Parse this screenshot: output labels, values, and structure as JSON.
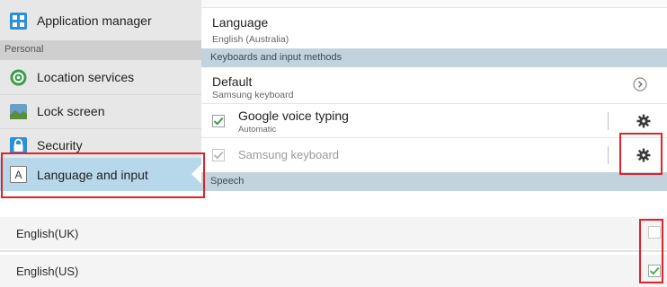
{
  "sidebar": {
    "items": [
      {
        "label": "Application manager",
        "icon": "grid-icon"
      },
      {
        "label": "Location services",
        "icon": "location-icon"
      },
      {
        "label": "Lock screen",
        "icon": "lock-screen-icon"
      },
      {
        "label": "Security",
        "icon": "padlock-icon"
      },
      {
        "label": "Language and input",
        "icon": "keyboard-a-icon"
      }
    ],
    "section_personal": "Personal"
  },
  "content": {
    "language": {
      "title": "Language",
      "value": "English (Australia)"
    },
    "section_keyboards": "Keyboards and input methods",
    "default": {
      "title": "Default",
      "value": "Samsung keyboard"
    },
    "google_voice": {
      "title": "Google voice typing",
      "sub": "Automatic",
      "checked": true
    },
    "samsung_keyboard": {
      "title": "Samsung keyboard",
      "checked": true,
      "disabled": true
    },
    "section_speech": "Speech"
  },
  "languages": [
    {
      "label": "English(UK)",
      "checked": false
    },
    {
      "label": "English(US)",
      "checked": true
    }
  ],
  "colors": {
    "highlight_red": "#e0232b",
    "selected_bg": "#b7d7ea",
    "check_green": "#4caf50",
    "section_blue": "#c3d3de"
  }
}
